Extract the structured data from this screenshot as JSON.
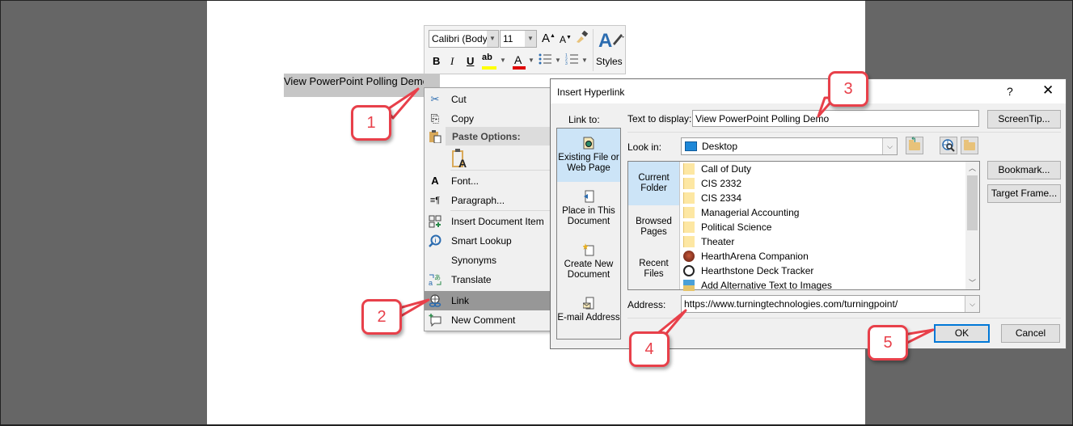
{
  "document": {
    "selected_text": "View PowerPoint Polling Demo"
  },
  "mini_toolbar": {
    "font_name": "Calibri (Body)",
    "font_size": "11",
    "grow_font": "A",
    "shrink_font": "A",
    "bold": "B",
    "italic": "I",
    "underline": "U",
    "highlight": "ab",
    "font_color": "A",
    "styles_label": "Styles",
    "highlight_color": "#ffff00",
    "font_color_value": "#e00000"
  },
  "context_menu": {
    "paste_header": "Paste Options:",
    "items": [
      {
        "label": "Cut",
        "icon": "scissors-icon"
      },
      {
        "label": "Copy",
        "icon": "copy-icon"
      },
      {
        "label": "Font...",
        "icon": "font-icon"
      },
      {
        "label": "Paragraph...",
        "icon": "paragraph-icon"
      },
      {
        "label": "Insert Document Item",
        "icon": "insert-item-icon"
      },
      {
        "label": "Smart Lookup",
        "icon": "smart-lookup-icon"
      },
      {
        "label": "Synonyms",
        "icon": ""
      },
      {
        "label": "Translate",
        "icon": "translate-icon"
      },
      {
        "label": "Link",
        "icon": "link-icon",
        "highlighted": true
      },
      {
        "label": "New Comment",
        "icon": "new-comment-icon"
      }
    ]
  },
  "dialog": {
    "title": "Insert Hyperlink",
    "help": "?",
    "close": "✕",
    "link_to_label": "Link to:",
    "link_to": [
      {
        "label": "Existing File or Web Page",
        "selected": true
      },
      {
        "label": "Place in This Document"
      },
      {
        "label": "Create New Document"
      },
      {
        "label": "E-mail Address"
      }
    ],
    "text_to_display_label": "Text to display:",
    "text_to_display_value": "View PowerPoint Polling Demo",
    "screentip_button": "ScreenTip...",
    "look_in_label": "Look in:",
    "look_in_value": "Desktop",
    "browse_nav": [
      {
        "label": "Current Folder",
        "selected": true
      },
      {
        "label": "Browsed Pages"
      },
      {
        "label": "Recent Files"
      }
    ],
    "files": [
      {
        "name": "Call of Duty",
        "type": "folder"
      },
      {
        "name": "CIS 2332",
        "type": "folder"
      },
      {
        "name": "CIS 2334",
        "type": "folder"
      },
      {
        "name": "Managerial Accounting",
        "type": "folder"
      },
      {
        "name": "Political Science",
        "type": "folder"
      },
      {
        "name": "Theater",
        "type": "folder"
      },
      {
        "name": "HearthArena Companion",
        "type": "app1"
      },
      {
        "name": "Hearthstone Deck Tracker",
        "type": "app2"
      },
      {
        "name": "Add Alternative Text to Images",
        "type": "img"
      }
    ],
    "bookmark_button": "Bookmark...",
    "target_frame_button": "Target Frame...",
    "address_label": "Address:",
    "address_value": "https://www.turningtechnologies.com/turningpoint/",
    "ok_button": "OK",
    "cancel_button": "Cancel"
  },
  "callouts": [
    "1",
    "2",
    "3",
    "4",
    "5"
  ],
  "colors": {
    "callout_red": "#e8404a",
    "selection_blue": "#cce4f7",
    "default_button_border": "#0078d7",
    "menu_highlight": "#979797"
  }
}
